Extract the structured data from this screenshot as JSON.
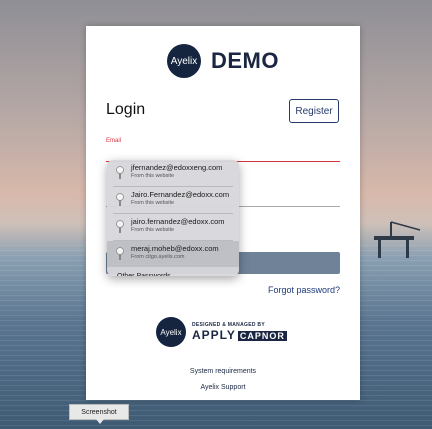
{
  "brand": {
    "logo_text": "Ayelix",
    "name": "DEMO"
  },
  "login": {
    "title": "Login",
    "register_label": "Register",
    "email_label": "Email",
    "forgot_label": "Forgot password?"
  },
  "autofill": {
    "items": [
      {
        "email": "jfernandez@edoxxeng.com",
        "source": "From this website"
      },
      {
        "email": "Jairo.Fernandez@edoxx.com",
        "source": "From this website"
      },
      {
        "email": "jairo.fernandez@edoxx.com",
        "source": "From this website"
      },
      {
        "email": "meraj.moheb@edoxx.com",
        "source": "From citgo.ayelix.com"
      }
    ],
    "other_label": "Other Passwords..."
  },
  "footer": {
    "logo_text": "Ayelix",
    "managed_text": "DESIGNED & MANAGED BY",
    "apply_text": "APPLY",
    "capnor_text": "CAPNOR",
    "system_requirements": "System requirements",
    "support": "Ayelix Support"
  },
  "tooltip": {
    "label": "Screenshot"
  },
  "colors": {
    "accent": "#263a6a",
    "error": "#d9333f",
    "button": "#6f8298"
  }
}
